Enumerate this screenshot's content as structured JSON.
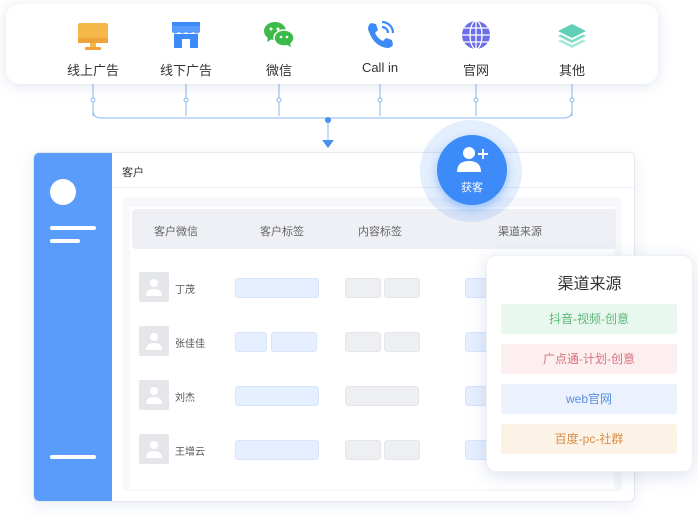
{
  "channels": [
    {
      "label": "线上广告",
      "icon": "monitor-icon"
    },
    {
      "label": "线下广告",
      "icon": "storefront-icon"
    },
    {
      "label": "微信",
      "icon": "wechat-icon"
    },
    {
      "label": "Call in",
      "icon": "phone-call-icon"
    },
    {
      "label": "官网",
      "icon": "globe-icon"
    },
    {
      "label": "其他",
      "icon": "layers-icon"
    }
  ],
  "window": {
    "title": "客户"
  },
  "table": {
    "headers": [
      "客户微信",
      "客户标签",
      "内容标签",
      "渠道来源"
    ],
    "rows": [
      {
        "name": "丁茂"
      },
      {
        "name": "张佳佳"
      },
      {
        "name": "刘杰"
      },
      {
        "name": "王增云"
      }
    ]
  },
  "badge": {
    "label": "获客",
    "icon": "add-user-icon"
  },
  "sources": {
    "title": "渠道来源",
    "items": [
      {
        "label": "抖音-视频-创意",
        "bg": "#e9f8ee",
        "color": "#5cb77a"
      },
      {
        "label": "广点通-计划-创意",
        "bg": "#fdeef0",
        "color": "#d9737f"
      },
      {
        "label": "web官网",
        "bg": "#ebf2fe",
        "color": "#5a8ee0"
      },
      {
        "label": "百度-pc-社群",
        "bg": "#fdf2e6",
        "color": "#d58f4e"
      }
    ]
  },
  "colors": {
    "accent": "#3d8bf8",
    "sidebar": "#5a9cfb",
    "line": "#6fa8f5"
  }
}
